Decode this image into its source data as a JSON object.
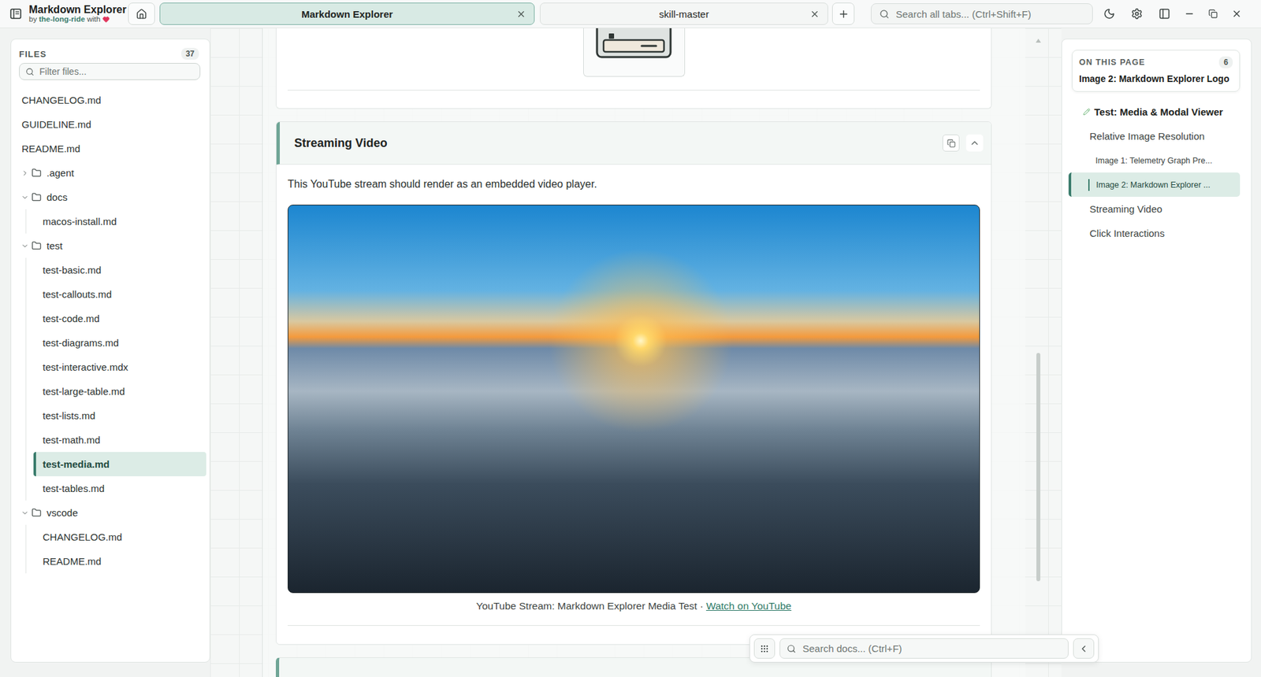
{
  "app": {
    "title": "Markdown Explorer",
    "byline_prefix": "by",
    "author": "the-long-ride",
    "byline_suffix": "with"
  },
  "tabs": [
    {
      "label": "Markdown Explorer",
      "selected": true
    },
    {
      "label": "skill-master",
      "selected": false
    }
  ],
  "global_search": {
    "placeholder": "Search all tabs... (Ctrl+Shift+F)"
  },
  "files": {
    "header": "FILES",
    "count": "37",
    "filter_placeholder": "Filter files...",
    "tree": [
      {
        "kind": "file",
        "label": "CHANGELOG.md",
        "selected": false
      },
      {
        "kind": "file",
        "label": "GUIDELINE.md",
        "selected": false
      },
      {
        "kind": "file",
        "label": "README.md",
        "selected": false
      },
      {
        "kind": "folder",
        "label": ".agent",
        "expanded": false,
        "children": []
      },
      {
        "kind": "folder",
        "label": "docs",
        "expanded": true,
        "children": [
          {
            "kind": "file",
            "label": "macos-install.md",
            "selected": false
          }
        ]
      },
      {
        "kind": "folder",
        "label": "test",
        "expanded": true,
        "children": [
          {
            "kind": "file",
            "label": "test-basic.md",
            "selected": false
          },
          {
            "kind": "file",
            "label": "test-callouts.md",
            "selected": false
          },
          {
            "kind": "file",
            "label": "test-code.md",
            "selected": false
          },
          {
            "kind": "file",
            "label": "test-diagrams.md",
            "selected": false
          },
          {
            "kind": "file",
            "label": "test-interactive.mdx",
            "selected": false
          },
          {
            "kind": "file",
            "label": "test-large-table.md",
            "selected": false
          },
          {
            "kind": "file",
            "label": "test-lists.md",
            "selected": false
          },
          {
            "kind": "file",
            "label": "test-math.md",
            "selected": false
          },
          {
            "kind": "file",
            "label": "test-media.md",
            "selected": true
          },
          {
            "kind": "file",
            "label": "test-tables.md",
            "selected": false
          }
        ]
      },
      {
        "kind": "folder",
        "label": "vscode",
        "expanded": true,
        "children": [
          {
            "kind": "file",
            "label": "CHANGELOG.md",
            "selected": false
          },
          {
            "kind": "file",
            "label": "README.md",
            "selected": false
          }
        ]
      }
    ]
  },
  "document": {
    "section": {
      "title": "Streaming Video",
      "expanded": true,
      "text": "This YouTube stream should render as an embedded video player.",
      "caption": "YouTube Stream: Markdown Explorer Media Test",
      "separator": "·",
      "link": "Watch on YouTube"
    }
  },
  "document_scroll": {
    "offset": 0.5,
    "level": 0.375
  },
  "toc": {
    "header": "ON THIS PAGE",
    "count": "6",
    "current": "Image 2: Markdown Explorer Logo",
    "items": [
      {
        "kind": "h1",
        "label": "Test: Media & Modal Viewer",
        "selected": false
      },
      {
        "kind": "h2",
        "label": "Relative Image Resolution",
        "selected": false
      },
      {
        "kind": "h3",
        "label": "Image 1: Telemetry Graph Pre...",
        "selected": false
      },
      {
        "kind": "h3",
        "label": "Image 2: Markdown Explorer ...",
        "selected": true
      },
      {
        "kind": "h2",
        "label": "Streaming Video",
        "selected": false
      },
      {
        "kind": "h2",
        "label": "Click Interactions",
        "selected": false
      }
    ]
  },
  "doc_search": {
    "placeholder": "Search docs... (Ctrl+F)"
  }
}
